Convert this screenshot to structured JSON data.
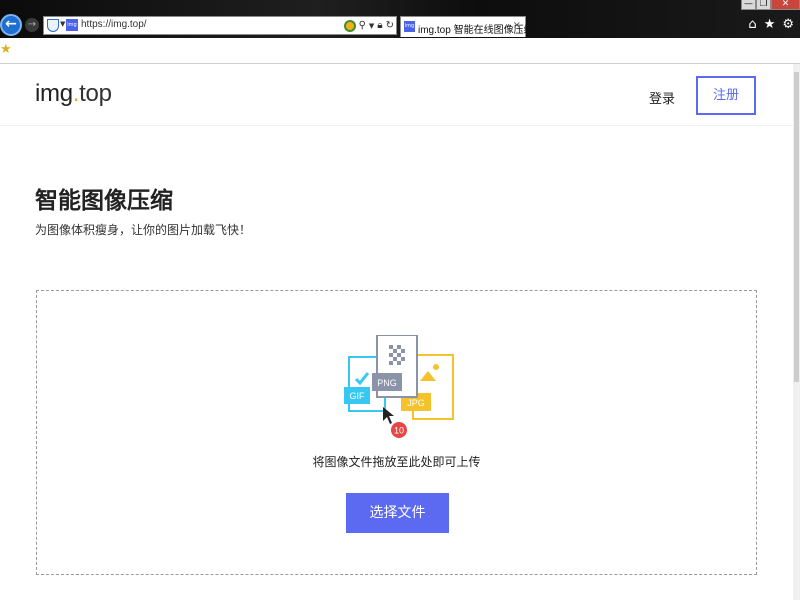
{
  "browser": {
    "url": "https://img.top/",
    "tab_title": "img.top 智能在线图像压缩",
    "tab_close": "×",
    "favicon_text": "img",
    "window_controls": [
      "—",
      "❐",
      "✕"
    ],
    "toolbar_icons": [
      "home-icon",
      "star-icon",
      "gear-icon"
    ]
  },
  "header": {
    "logo_main": "img",
    "logo_dot": ".",
    "logo_suffix": "top",
    "login_label": "登录",
    "register_label": "注册"
  },
  "hero": {
    "title": "智能图像压缩",
    "subtitle": "为图像体积瘦身，让你的图片加载飞快！"
  },
  "upload": {
    "drop_hint": "将图像文件拖放至此处即可上传",
    "choose_button": "选择文件",
    "file_types": [
      "GIF",
      "PNG",
      "JPG"
    ],
    "count_badge": "10"
  },
  "colors": {
    "accent": "#5b6af0",
    "gif": "#36c8f0",
    "png": "#8a93a8",
    "jpg": "#f6c22b",
    "badge": "#e84545"
  }
}
